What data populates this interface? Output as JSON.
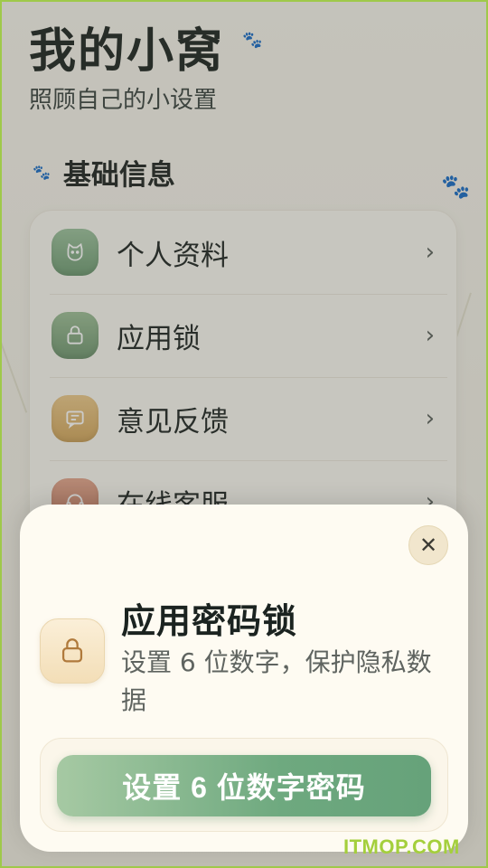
{
  "header": {
    "title": "我的小窝",
    "subtitle": "照顾自己的小设置",
    "title_icon": "paw-icon"
  },
  "section": {
    "title": "基础信息",
    "icon": "paw-icon"
  },
  "menu": [
    {
      "label": "个人资料",
      "icon": "cat-face-icon",
      "color": "#7fa883"
    },
    {
      "label": "应用锁",
      "icon": "lock-icon",
      "color": "#7fa07a"
    },
    {
      "label": "意见反馈",
      "icon": "message-icon",
      "color": "#d9b36f"
    },
    {
      "label": "在线客服",
      "icon": "headset-icon",
      "color": "#c78c73"
    }
  ],
  "modal": {
    "title": "应用密码锁",
    "description": "设置 6 位数字，保护隐私数据",
    "cta_label": "设置 6 位数字密码",
    "close_icon": "close-icon",
    "lock_icon": "lock-icon",
    "accent": "#6ea97f"
  },
  "watermark": "ITMOP.COM"
}
